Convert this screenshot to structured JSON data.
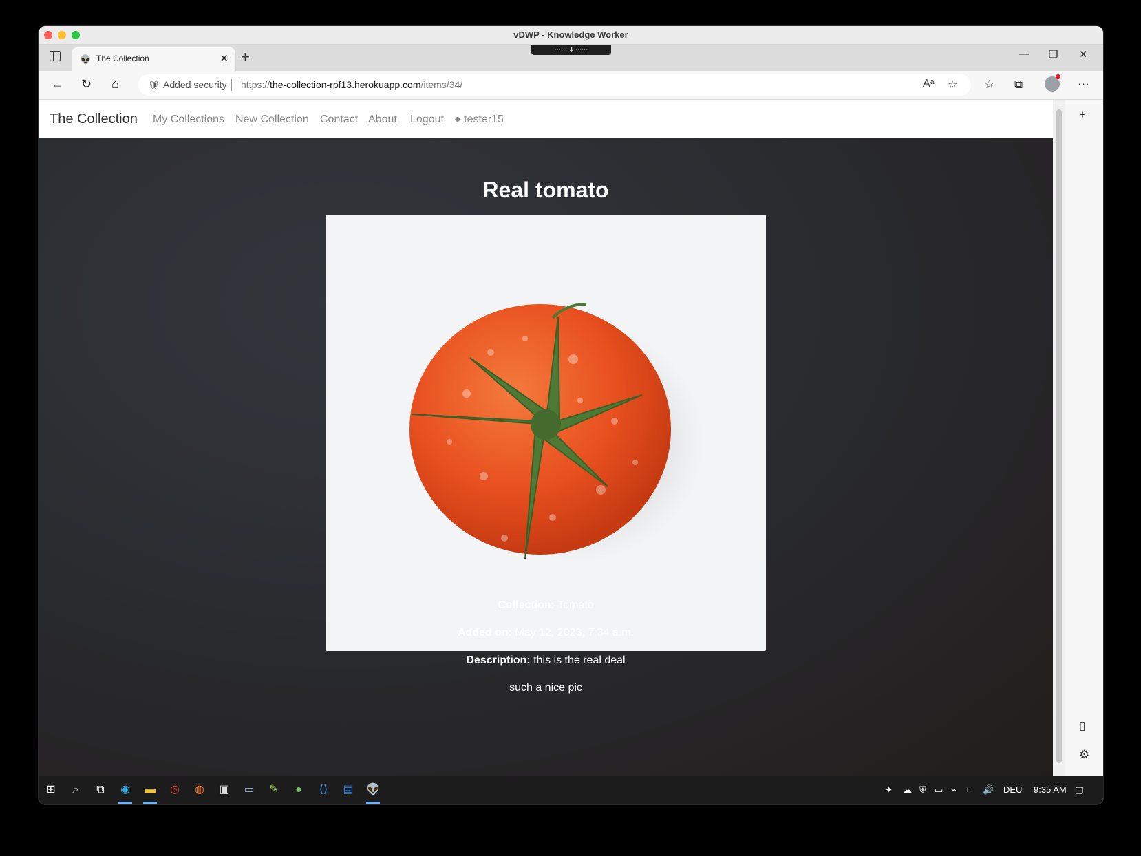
{
  "window": {
    "title": "vDWP - Knowledge Worker"
  },
  "browser": {
    "tab": {
      "title": "The Collection",
      "favicon": "alien-icon"
    },
    "address": {
      "security_label": "Added security",
      "url_prefix": "https://",
      "url_host": "the-collection-rpf13.herokuapp.com",
      "url_path": "/items/34/"
    }
  },
  "site": {
    "brand": "The Collection",
    "nav": {
      "my_collections": "My Collections",
      "new_collection": "New Collection",
      "contact": "Contact",
      "about": "About",
      "logout": "Logout",
      "user": "tester15"
    }
  },
  "item": {
    "title": "Real tomato",
    "collection_label": "Collection:",
    "collection_value": "Tomato",
    "added_label": "Added on:",
    "added_value": "May 12, 2023, 7:34 a.m.",
    "description_label": "Description:",
    "description_value": "this is the real deal",
    "note": "such a nice pic"
  },
  "taskbar": {
    "language": "DEU",
    "time": "9:35 AM"
  },
  "colors": {
    "page_bg": "#2a2c30",
    "tomato": "#e8501f",
    "nav_text": "#888888"
  }
}
